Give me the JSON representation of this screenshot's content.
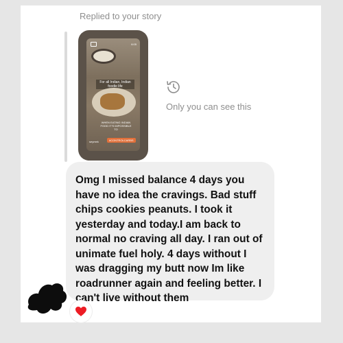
{
  "reply_context": {
    "label": "Replied to your story"
  },
  "story_preview": {
    "time": "6:05",
    "caption_top": "For all Indian, Indian foodie life",
    "caption_bottom": "WHEN EATING INDIAN FOOD IT'S IMPOSSIBLE TO",
    "username": "seymek",
    "hashtag": "#CONTROLCARBS"
  },
  "visibility": {
    "icon": "history-icon",
    "text": "Only you can see this"
  },
  "message": {
    "text": "Omg I missed balance 4 days you have no idea the cravings. Bad stuff chips cookies peanuts. I took it yesterday and today.I am back to normal no craving all day. I ran out of unimate fuel holy. 4 days without I was dragging my butt now Im like roadrunner again and feeling better. I can't  live without them"
  },
  "reaction": {
    "icon": "heart-icon",
    "color": "#ed1c24"
  }
}
